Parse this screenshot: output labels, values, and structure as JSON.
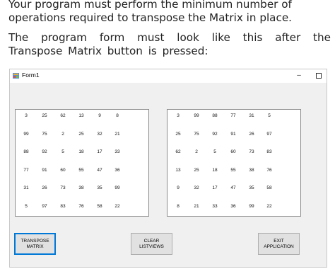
{
  "intro": {
    "line1": "Your program must perform the minimum number of operations required to transpose the Matrix in place.",
    "line2": "The program form must look like this after the Transpose Matrix button is pressed:"
  },
  "window": {
    "title": "Form1",
    "minimize_symbol": "–"
  },
  "matrix_original": [
    [
      "3",
      "25",
      "62",
      "13",
      "9",
      "8"
    ],
    [
      "99",
      "75",
      "2",
      "25",
      "32",
      "21"
    ],
    [
      "88",
      "92",
      "5",
      "18",
      "17",
      "33"
    ],
    [
      "77",
      "91",
      "60",
      "55",
      "47",
      "36"
    ],
    [
      "31",
      "26",
      "73",
      "38",
      "35",
      "99"
    ],
    [
      "5",
      "97",
      "83",
      "76",
      "58",
      "22"
    ]
  ],
  "matrix_transposed": [
    [
      "3",
      "99",
      "88",
      "77",
      "31",
      "5"
    ],
    [
      "25",
      "75",
      "92",
      "91",
      "26",
      "97"
    ],
    [
      "62",
      "2",
      "5",
      "60",
      "73",
      "83"
    ],
    [
      "13",
      "25",
      "18",
      "55",
      "38",
      "76"
    ],
    [
      "9",
      "32",
      "17",
      "47",
      "35",
      "58"
    ],
    [
      "8",
      "21",
      "33",
      "36",
      "99",
      "22"
    ]
  ],
  "buttons": {
    "transpose": "TRANSPOSE MATRIX",
    "clear": "CLEAR LISTVIEWS",
    "exit": "EXIT APPLICATION"
  }
}
